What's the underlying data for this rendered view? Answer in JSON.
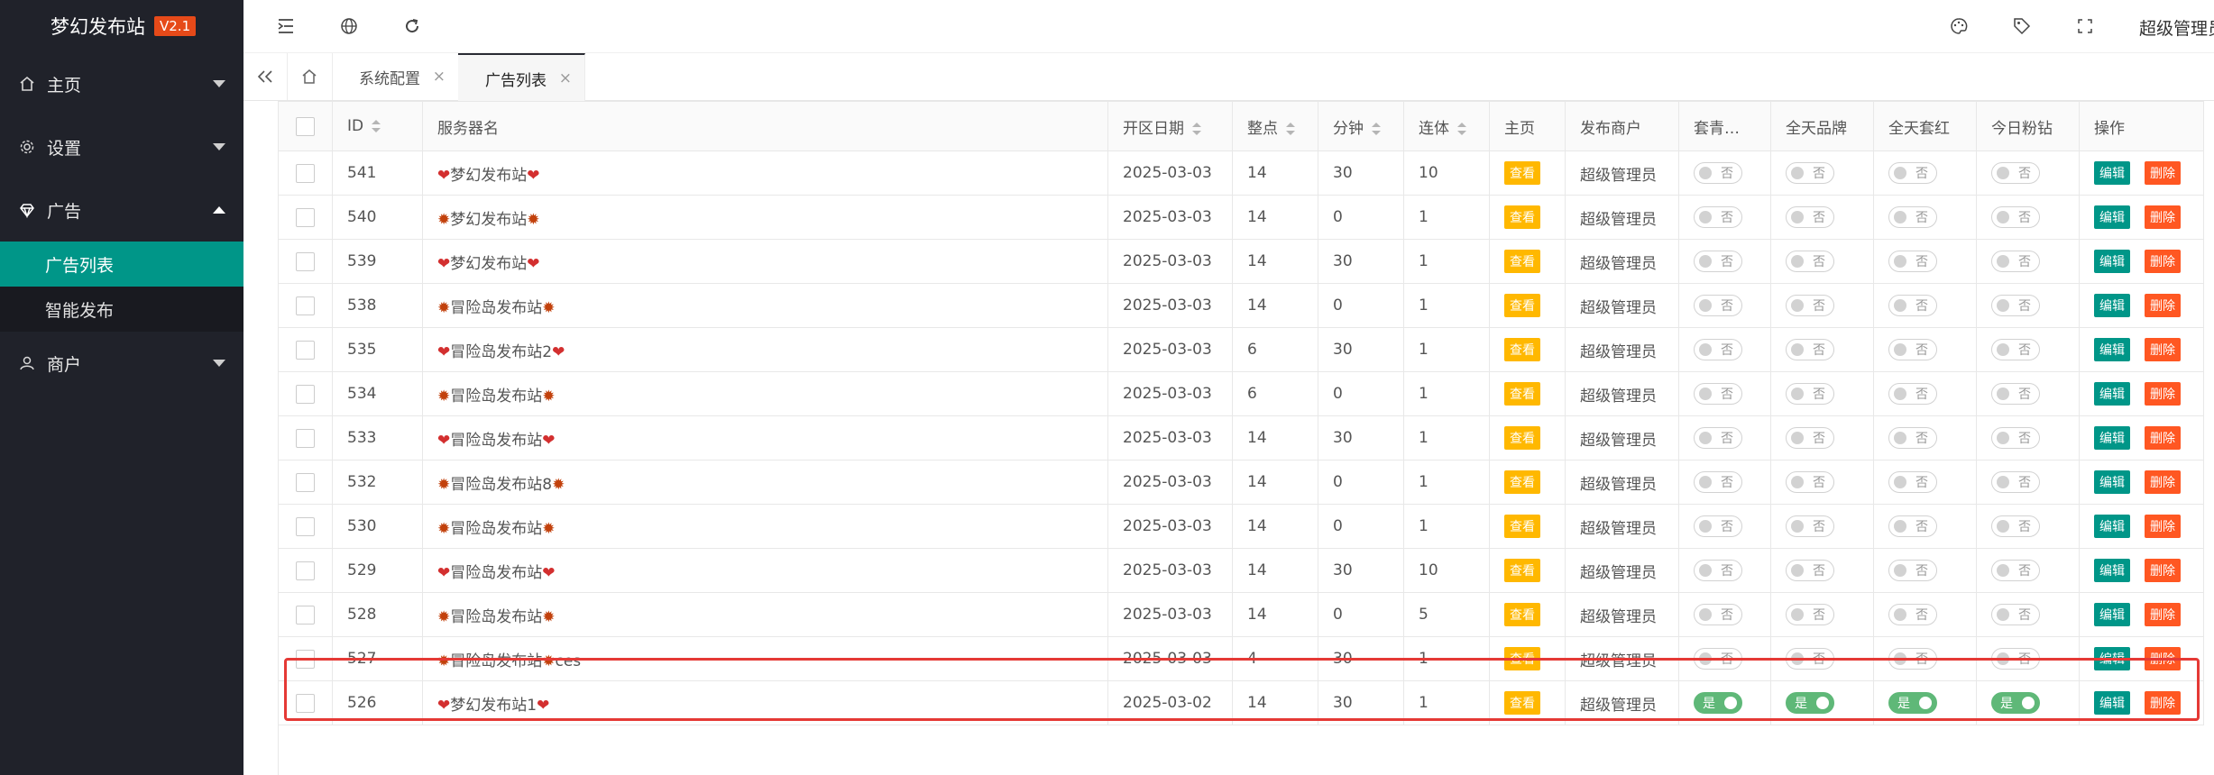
{
  "sidebar": {
    "logo": "梦幻发布站",
    "version": "V2.1",
    "nav": [
      {
        "label": "主页",
        "icon": "home-icon",
        "expanded": false
      },
      {
        "label": "设置",
        "icon": "gear-icon",
        "expanded": false
      },
      {
        "label": "广告",
        "icon": "diamond-icon",
        "expanded": true,
        "children": [
          {
            "label": "广告列表",
            "active": true
          },
          {
            "label": "智能发布",
            "active": false
          }
        ]
      },
      {
        "label": "商户",
        "icon": "user-icon",
        "expanded": false
      }
    ]
  },
  "header": {
    "icons": [
      "menu-fold-icon",
      "globe-icon",
      "refresh-icon",
      "theme-palette-icon",
      "tag-icon",
      "fullscreen-icon"
    ],
    "user": "超级管理员"
  },
  "tabs": {
    "items": [
      {
        "label": "系统配置",
        "active": false
      },
      {
        "label": "广告列表",
        "active": true
      }
    ]
  },
  "table": {
    "columns": [
      "ID",
      "服务器名",
      "开区日期",
      "整点",
      "分钟",
      "连体",
      "主页",
      "发布商户",
      "套青…",
      "全天品牌",
      "全天套红",
      "今日粉钻",
      "操作"
    ],
    "sortable": [
      true,
      false,
      true,
      true,
      true,
      true,
      false,
      false,
      false,
      false,
      false,
      false,
      false
    ],
    "view_label": "查看",
    "edit_label": "编辑",
    "delete_label": "删除",
    "on_label": "是",
    "off_label": "否",
    "rows": [
      {
        "id": "541",
        "icon": "heart",
        "name": "梦幻发布站",
        "suffix": "",
        "date": "2025-03-03",
        "hour": "14",
        "minute": "30",
        "combo": "10",
        "merchant": "超级管理员",
        "flags": [
          false,
          false,
          false,
          false
        ]
      },
      {
        "id": "540",
        "icon": "leaf",
        "name": "梦幻发布站",
        "suffix": "",
        "date": "2025-03-03",
        "hour": "14",
        "minute": "0",
        "combo": "1",
        "merchant": "超级管理员",
        "flags": [
          false,
          false,
          false,
          false
        ]
      },
      {
        "id": "539",
        "icon": "heart",
        "name": "梦幻发布站",
        "suffix": "",
        "date": "2025-03-03",
        "hour": "14",
        "minute": "30",
        "combo": "1",
        "merchant": "超级管理员",
        "flags": [
          false,
          false,
          false,
          false
        ]
      },
      {
        "id": "538",
        "icon": "leaf",
        "name": "冒险岛发布站",
        "suffix": "",
        "date": "2025-03-03",
        "hour": "14",
        "minute": "0",
        "combo": "1",
        "merchant": "超级管理员",
        "flags": [
          false,
          false,
          false,
          false
        ]
      },
      {
        "id": "535",
        "icon": "heart",
        "name": "冒险岛发布站2",
        "suffix": "",
        "date": "2025-03-03",
        "hour": "6",
        "minute": "30",
        "combo": "1",
        "merchant": "超级管理员",
        "flags": [
          false,
          false,
          false,
          false
        ]
      },
      {
        "id": "534",
        "icon": "leaf",
        "name": "冒险岛发布站",
        "suffix": "",
        "date": "2025-03-03",
        "hour": "6",
        "minute": "0",
        "combo": "1",
        "merchant": "超级管理员",
        "flags": [
          false,
          false,
          false,
          false
        ]
      },
      {
        "id": "533",
        "icon": "heart",
        "name": "冒险岛发布站",
        "suffix": "",
        "date": "2025-03-03",
        "hour": "14",
        "minute": "30",
        "combo": "1",
        "merchant": "超级管理员",
        "flags": [
          false,
          false,
          false,
          false
        ]
      },
      {
        "id": "532",
        "icon": "leaf",
        "name": "冒险岛发布站8",
        "suffix": "",
        "date": "2025-03-03",
        "hour": "14",
        "minute": "0",
        "combo": "1",
        "merchant": "超级管理员",
        "flags": [
          false,
          false,
          false,
          false
        ]
      },
      {
        "id": "530",
        "icon": "leaf",
        "name": "冒险岛发布站",
        "suffix": "",
        "date": "2025-03-03",
        "hour": "14",
        "minute": "0",
        "combo": "1",
        "merchant": "超级管理员",
        "flags": [
          false,
          false,
          false,
          false
        ]
      },
      {
        "id": "529",
        "icon": "heart",
        "name": "冒险岛发布站",
        "suffix": "",
        "date": "2025-03-03",
        "hour": "14",
        "minute": "30",
        "combo": "10",
        "merchant": "超级管理员",
        "flags": [
          false,
          false,
          false,
          false
        ]
      },
      {
        "id": "528",
        "icon": "leaf",
        "name": "冒险岛发布站",
        "suffix": "",
        "date": "2025-03-03",
        "hour": "14",
        "minute": "0",
        "combo": "5",
        "merchant": "超级管理员",
        "flags": [
          false,
          false,
          false,
          false
        ]
      },
      {
        "id": "527",
        "icon": "leaf",
        "name": "冒险岛发布站",
        "suffix": "ces",
        "date": "2025-03-03",
        "hour": "4",
        "minute": "30",
        "combo": "1",
        "merchant": "超级管理员",
        "flags": [
          false,
          false,
          false,
          false
        ]
      },
      {
        "id": "526",
        "icon": "heart",
        "name": "梦幻发布站1",
        "suffix": "",
        "date": "2025-03-02",
        "hour": "14",
        "minute": "30",
        "combo": "1",
        "merchant": "超级管理员",
        "flags": [
          true,
          true,
          true,
          true
        ]
      }
    ]
  },
  "colors": {
    "accent": "#009688",
    "view": "#ffb800",
    "danger": "#ff5722",
    "switch_on": "#5fb878",
    "highlight": "#e53935"
  }
}
